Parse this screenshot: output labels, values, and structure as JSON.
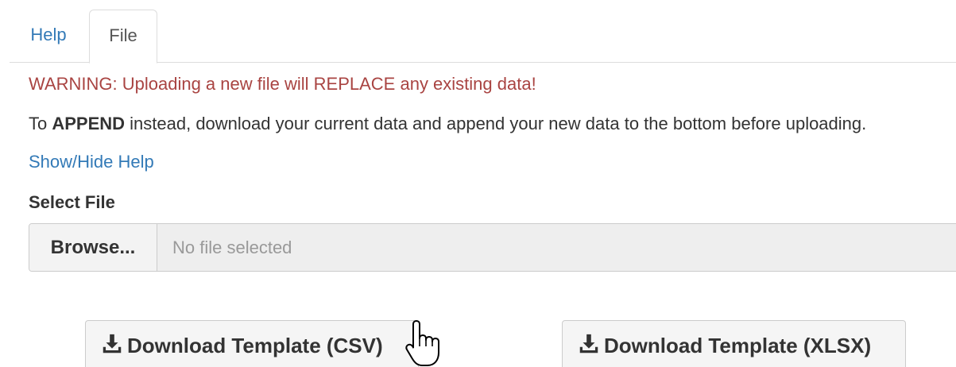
{
  "tabs": {
    "help": "Help",
    "file": "File"
  },
  "warning": {
    "prefix": "WARNING: Uploading a new file will ",
    "emphasis": "REPLACE",
    "suffix": " any existing data!"
  },
  "append_note": {
    "prefix": "To ",
    "emphasis": "APPEND",
    "suffix": " instead, download your current data and append your new data to the bottom before uploading."
  },
  "help_toggle": "Show/Hide Help",
  "file_input": {
    "label": "Select File",
    "browse_label": "Browse...",
    "placeholder": "No file selected"
  },
  "downloads": {
    "csv_label": "Download Template (CSV)",
    "xlsx_label": "Download Template (XLSX)",
    "icon": "download-icon"
  },
  "colors": {
    "link": "#337ab7",
    "warning": "#a94442"
  }
}
